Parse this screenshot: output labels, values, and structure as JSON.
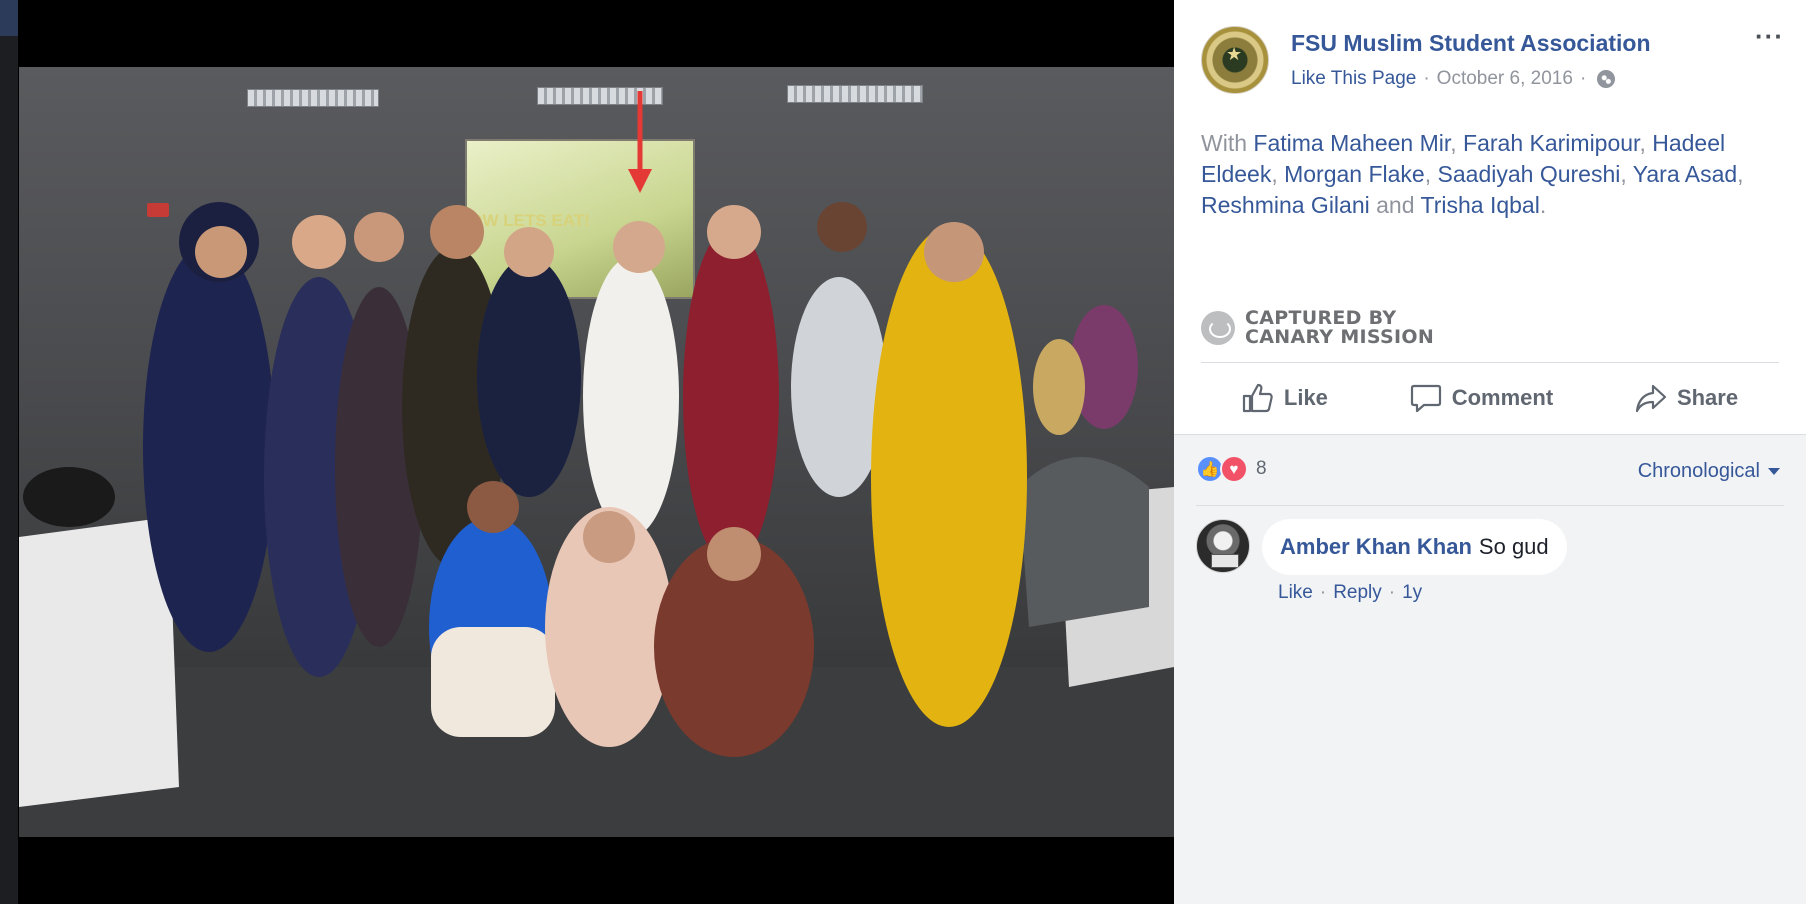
{
  "photo": {
    "screen_text": "NOW LETS EAT!",
    "alt": ""
  },
  "post": {
    "page_name": "FSU Muslim Student Association",
    "like_page": "Like This Page",
    "separator": "·",
    "date": "October 6, 2016",
    "privacy_icon": "globe-icon",
    "more_icon": "more-icon",
    "with_prefix": "With",
    "tagged": [
      "Fatima Maheen Mir",
      "Farah Karimipour",
      "Hadeel Eldeek",
      "Morgan Flake",
      "Saadiyah Qureshi",
      "Yara Asad",
      "Reshmina Gilani",
      "Trisha Iqbal"
    ],
    "comma": ",",
    "and_word": "and",
    "period": "."
  },
  "watermark": {
    "line1": "CAPTURED BY",
    "line2": "CANARY MISSION"
  },
  "actions": {
    "like": "Like",
    "comment": "Comment",
    "share": "Share"
  },
  "reactions": {
    "count": "8",
    "types": [
      "like",
      "love"
    ]
  },
  "sort": {
    "label": "Chronological"
  },
  "comments": [
    {
      "author": "Amber Khan Khan",
      "text": "So gud",
      "like": "Like",
      "reply": "Reply",
      "time": "1y"
    }
  ],
  "colors": {
    "link": "#365899",
    "muted": "#90949c",
    "arrow": "#e53935",
    "like": "#5890ff",
    "love": "#f25268"
  }
}
